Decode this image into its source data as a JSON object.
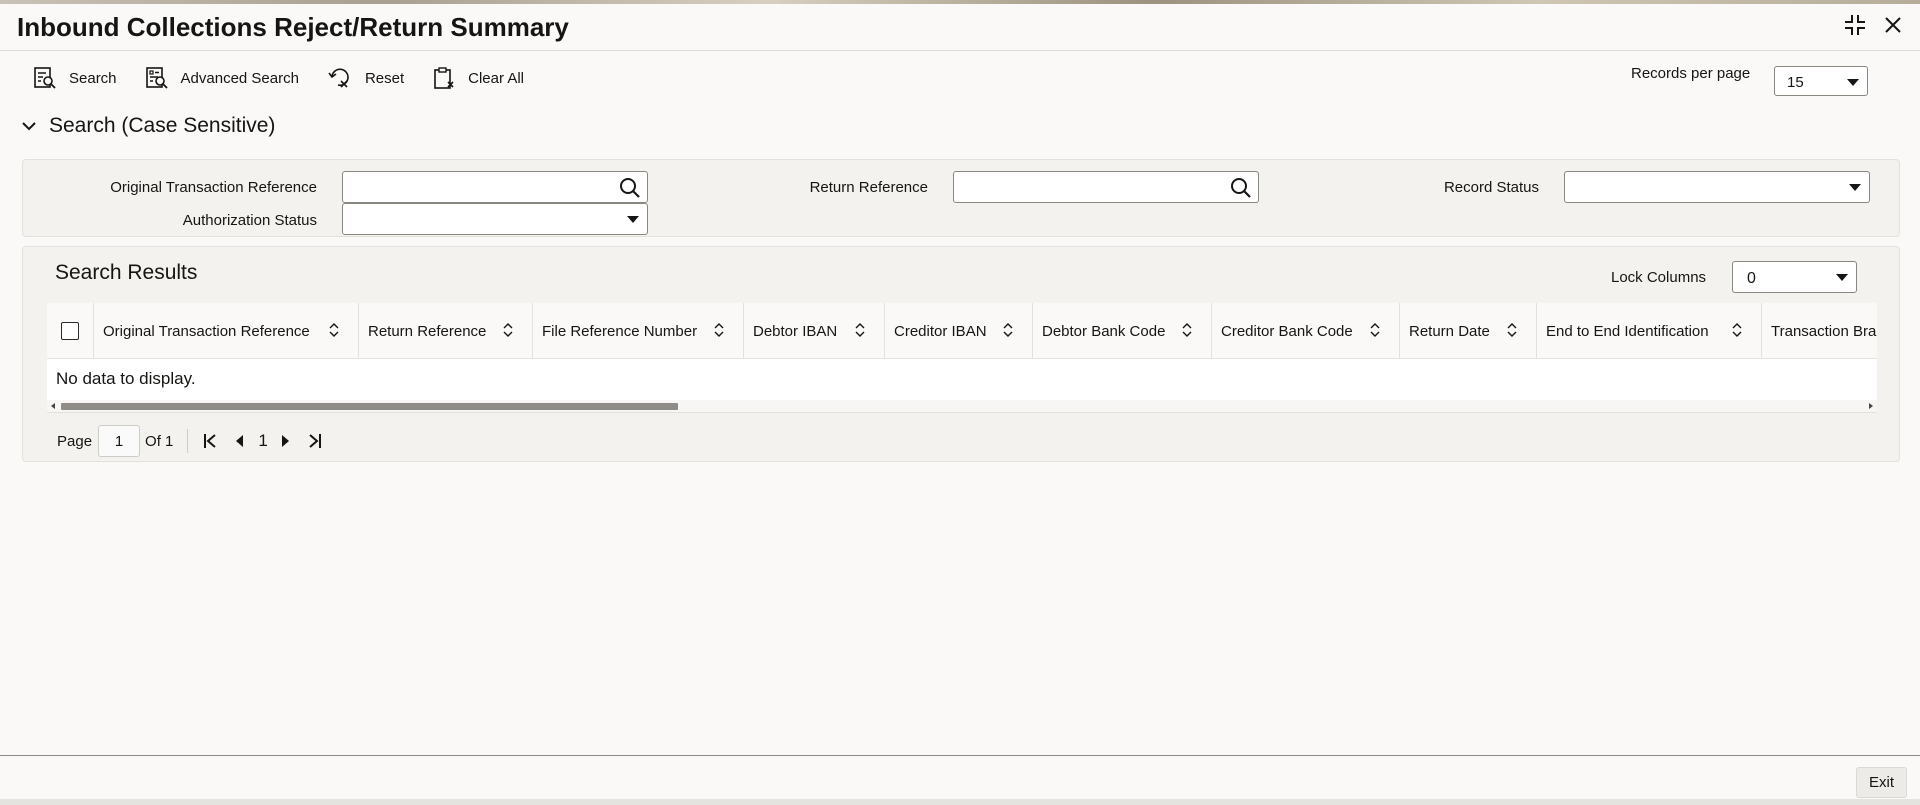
{
  "window": {
    "title": "Inbound Collections Reject/Return Summary"
  },
  "toolbar": {
    "search_label": "Search",
    "advanced_search_label": "Advanced Search",
    "reset_label": "Reset",
    "clear_all_label": "Clear All"
  },
  "records_per_page": {
    "label": "Records per page",
    "value": "15"
  },
  "search_section": {
    "title": "Search (Case Sensitive)",
    "fields": {
      "original_transaction_reference": {
        "label": "Original Transaction Reference",
        "value": ""
      },
      "return_reference": {
        "label": "Return Reference",
        "value": ""
      },
      "record_status": {
        "label": "Record Status",
        "value": ""
      },
      "authorization_status": {
        "label": "Authorization Status",
        "value": ""
      }
    }
  },
  "results": {
    "title": "Search Results",
    "lock_columns_label": "Lock Columns",
    "lock_columns_value": "0",
    "columns": [
      "Original Transaction Reference",
      "Return Reference",
      "File Reference Number",
      "Debtor IBAN",
      "Creditor IBAN",
      "Debtor Bank Code",
      "Creditor Bank Code",
      "Return Date",
      "End to End Identification",
      "Transaction Bra"
    ],
    "empty_message": "No data to display.",
    "pagination": {
      "page_label": "Page",
      "current_page": "1",
      "of_label": "Of 1",
      "page_number": "1"
    }
  },
  "footer": {
    "exit_label": "Exit"
  },
  "colors": {
    "text": "#161513",
    "panel_bg": "#f3f2ef",
    "border": "#8a8680"
  }
}
